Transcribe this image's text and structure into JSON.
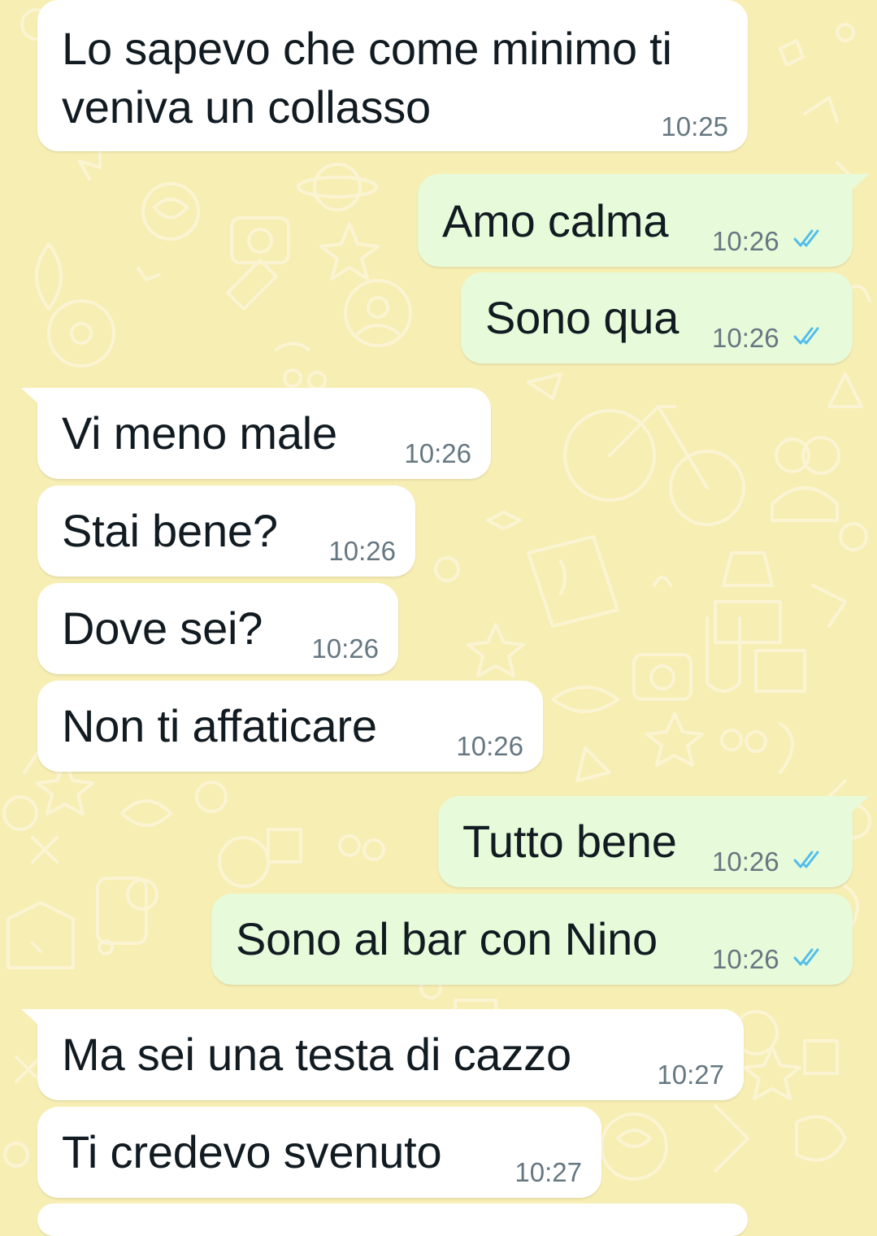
{
  "colors": {
    "background": "#f7eeb4",
    "incoming_bubble": "#ffffff",
    "outgoing_bubble": "#e7fbda",
    "read_ticks": "#53bdeb",
    "timestamp": "#667781"
  },
  "messages": [
    {
      "direction": "incoming",
      "text": "Lo sapevo che come minimo ti veniva un collasso",
      "time": "10:25"
    },
    {
      "direction": "outgoing",
      "text": "Amo calma",
      "time": "10:26",
      "status_icon": "double-check-read-icon"
    },
    {
      "direction": "outgoing",
      "text": "Sono qua",
      "time": "10:26",
      "status_icon": "double-check-read-icon"
    },
    {
      "direction": "incoming",
      "text": "Vi meno male",
      "time": "10:26"
    },
    {
      "direction": "incoming",
      "text": "Stai bene?",
      "time": "10:26"
    },
    {
      "direction": "incoming",
      "text": "Dove sei?",
      "time": "10:26"
    },
    {
      "direction": "incoming",
      "text": "Non ti affaticare",
      "time": "10:26"
    },
    {
      "direction": "outgoing",
      "text": "Tutto bene",
      "time": "10:26",
      "status_icon": "double-check-read-icon"
    },
    {
      "direction": "outgoing",
      "text": "Sono al bar con Nino",
      "time": "10:26",
      "status_icon": "double-check-read-icon"
    },
    {
      "direction": "incoming",
      "text": "Ma sei una testa di cazzo",
      "time": "10:27"
    },
    {
      "direction": "incoming",
      "text": "Ti credevo svenuto",
      "time": "10:27"
    }
  ]
}
